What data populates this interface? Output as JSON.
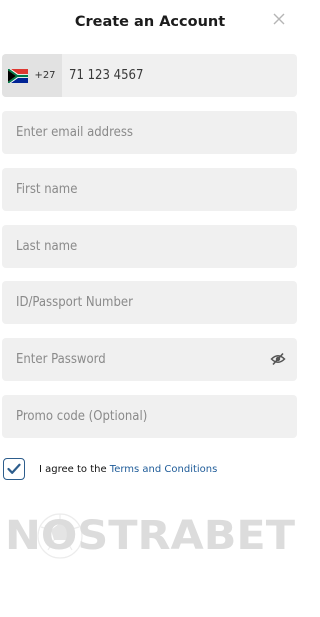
{
  "header": {
    "title": "Create an Account",
    "close_icon": "close-icon"
  },
  "phone": {
    "prefix": "+27",
    "value": "71 123 4567",
    "flag_icon": "south-africa-flag-icon"
  },
  "fields": {
    "email_placeholder": "Enter email address",
    "first_name_placeholder": "First name",
    "last_name_placeholder": "Last name",
    "id_placeholder": "ID/Passport Number",
    "password_placeholder": "Enter Password",
    "password_toggle_icon": "eye-slash-icon",
    "promo_placeholder": "Promo code (Optional)"
  },
  "agreement": {
    "checked": true,
    "text": "I agree to the",
    "link_text": "Terms and Conditions"
  },
  "logo": {
    "text": "NOSTRABET",
    "brand_icon": "soccer-ball-icon"
  },
  "colors": {
    "field_bg": "#f0f0f0",
    "prefix_bg": "#e2e2e2",
    "link": "#1f5c99",
    "logo": "#dcdcdc"
  }
}
